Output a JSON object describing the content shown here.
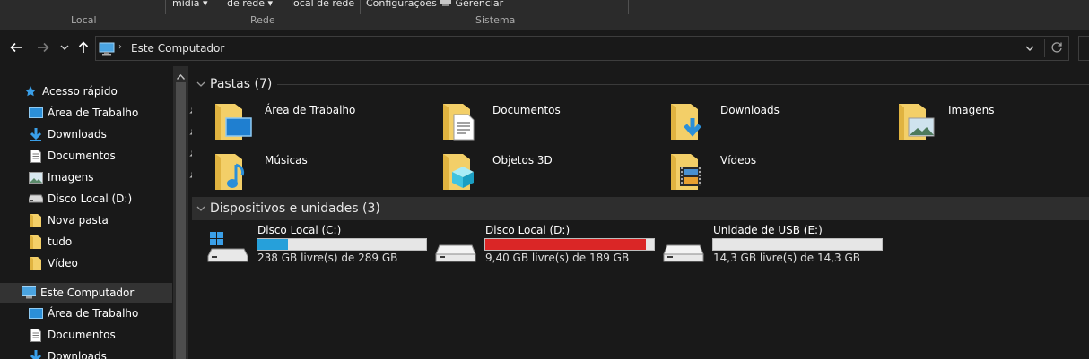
{
  "ribbon": {
    "groups": [
      {
        "label": "Local"
      },
      {
        "label": "Rede"
      },
      {
        "label": "Sistema"
      }
    ],
    "commands": {
      "midia": "mídia",
      "de_rede": "de rede",
      "local_de_rede": "local de rede",
      "configuracoes": "Configurações",
      "gerenciar": "Gerenciar"
    }
  },
  "address_bar": {
    "crumb": "Este Computador"
  },
  "sidebar": {
    "quick_access": "Acesso rápido",
    "quick_items": [
      {
        "label": "Área de Trabalho",
        "icon": "desktop-icon",
        "pinned": true
      },
      {
        "label": "Downloads",
        "icon": "download-icon",
        "pinned": true
      },
      {
        "label": "Documentos",
        "icon": "document-icon",
        "pinned": true
      },
      {
        "label": "Imagens",
        "icon": "pictures-icon",
        "pinned": true
      },
      {
        "label": "Disco Local (D:)",
        "icon": "drive-icon",
        "pinned": false
      },
      {
        "label": "Nova pasta",
        "icon": "folder-icon",
        "pinned": false
      },
      {
        "label": "tudo",
        "icon": "folder-icon",
        "pinned": false
      },
      {
        "label": "Vídeo",
        "icon": "folder-icon",
        "pinned": false
      }
    ],
    "this_pc": "Este Computador",
    "pc_items": [
      {
        "label": "Área de Trabalho",
        "icon": "desktop-icon"
      },
      {
        "label": "Documentos",
        "icon": "document-icon"
      },
      {
        "label": "Downloads",
        "icon": "download-icon"
      }
    ]
  },
  "content": {
    "folders_header": "Pastas (7)",
    "folders": [
      {
        "label": "Área de Trabalho",
        "icon": "desktop-folder-icon"
      },
      {
        "label": "Documentos",
        "icon": "documents-folder-icon"
      },
      {
        "label": "Downloads",
        "icon": "downloads-folder-icon"
      },
      {
        "label": "Imagens",
        "icon": "pictures-folder-icon"
      },
      {
        "label": "Músicas",
        "icon": "music-folder-icon"
      },
      {
        "label": "Objetos 3D",
        "icon": "3d-objects-folder-icon"
      },
      {
        "label": "Vídeos",
        "icon": "videos-folder-icon"
      }
    ],
    "drives_header": "Dispositivos e unidades (3)",
    "drives": [
      {
        "name": "Disco Local (C:)",
        "free": "238 GB livre(s) de 289 GB",
        "used_fraction": 0.18,
        "color": "#26a0da",
        "icon": "windows-drive-icon"
      },
      {
        "name": "Disco Local (D:)",
        "free": "9,40 GB livre(s) de 189 GB",
        "used_fraction": 0.95,
        "color": "#da2626",
        "icon": "hard-drive-icon"
      },
      {
        "name": "Unidade de USB (E:)",
        "free": "14,3 GB livre(s) de 14,3 GB",
        "used_fraction": 0.0,
        "color": "#26a0da",
        "icon": "usb-drive-icon"
      }
    ]
  }
}
